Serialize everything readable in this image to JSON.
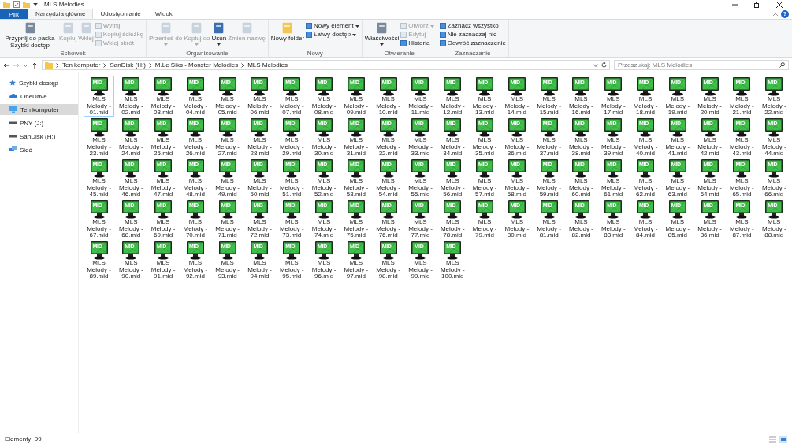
{
  "window": {
    "title": "MLS Melodies",
    "help": "?"
  },
  "tabs": [
    {
      "label": "Plik",
      "kind": "file",
      "selected": false
    },
    {
      "label": "Narzędzia główne",
      "kind": "tab",
      "selected": true
    },
    {
      "label": "Udostępnianie",
      "kind": "tab",
      "selected": false
    },
    {
      "label": "Widok",
      "kind": "tab",
      "selected": false
    }
  ],
  "ribbon": [
    {
      "name": "Schowek",
      "items": [
        {
          "label": "Przypnij do paska Szybki dostęp",
          "kind": "large",
          "disabled": false,
          "dropdown": false
        },
        {
          "label": "Kopiuj",
          "kind": "large",
          "disabled": true,
          "dropdown": false
        },
        {
          "label": "Wklej",
          "kind": "large",
          "disabled": true,
          "dropdown": false
        },
        {
          "label": "Wytnij",
          "kind": "small",
          "disabled": true,
          "dropdown": false
        },
        {
          "label": "Kopiuj ścieżkę",
          "kind": "small",
          "disabled": true,
          "dropdown": false
        },
        {
          "label": "Wklej skrót",
          "kind": "small",
          "disabled": true,
          "dropdown": false
        }
      ]
    },
    {
      "name": "Organizowanie",
      "items": [
        {
          "label": "Przenieś do",
          "kind": "large",
          "disabled": true,
          "dropdown": true
        },
        {
          "label": "Kopiuj do",
          "kind": "large",
          "disabled": true,
          "dropdown": true
        },
        {
          "label": "Usuń",
          "kind": "large",
          "disabled": false,
          "dropdown": true
        },
        {
          "label": "Zmień nazwę",
          "kind": "large",
          "disabled": true,
          "dropdown": false
        }
      ]
    },
    {
      "name": "Nowy",
      "items": [
        {
          "label": "Nowy folder",
          "kind": "large",
          "disabled": false,
          "dropdown": false
        },
        {
          "label": "Nowy element",
          "kind": "small",
          "disabled": false,
          "dropdown": true
        },
        {
          "label": "Łatwy dostęp",
          "kind": "small",
          "disabled": false,
          "dropdown": true
        }
      ]
    },
    {
      "name": "Otwieranie",
      "items": [
        {
          "label": "Właściwości",
          "kind": "large",
          "disabled": false,
          "dropdown": true
        },
        {
          "label": "Otwórz",
          "kind": "small",
          "disabled": true,
          "dropdown": true
        },
        {
          "label": "Edytuj",
          "kind": "small",
          "disabled": true,
          "dropdown": false
        },
        {
          "label": "Historia",
          "kind": "small",
          "disabled": false,
          "dropdown": false
        }
      ]
    },
    {
      "name": "Zaznaczanie",
      "items": [
        {
          "label": "Zaznacz wszystko",
          "kind": "small",
          "disabled": false,
          "dropdown": false
        },
        {
          "label": "Nie zaznaczaj nic",
          "kind": "small",
          "disabled": false,
          "dropdown": false
        },
        {
          "label": "Odwróć zaznaczenie",
          "kind": "small",
          "disabled": false,
          "dropdown": false
        }
      ]
    }
  ],
  "address": {
    "crumbs": [
      "Ten komputer",
      "SanDisk (H:)",
      "M.Le Siks - Monster Melodies",
      "MLS Melodies"
    ]
  },
  "search": {
    "placeholder": "Przeszukaj: MLS Melodies"
  },
  "sidebar": {
    "items": [
      {
        "label": "Szybki dostęp",
        "kind": "star",
        "selected": false
      },
      {
        "label": "OneDrive",
        "kind": "cloud",
        "selected": false
      },
      {
        "label": "Ten komputer",
        "kind": "pc",
        "selected": true
      },
      {
        "label": "PNY (J:)",
        "kind": "drive",
        "selected": false
      },
      {
        "label": "SanDisk (H:)",
        "kind": "drive",
        "selected": false
      },
      {
        "label": "Sieć",
        "kind": "network",
        "selected": false
      }
    ]
  },
  "files": [
    {
      "name": "MLS Melody - 01.mid",
      "badge": "MID",
      "selected": true
    },
    {
      "name": "MLS Melody - 02.mid",
      "badge": "MID",
      "selected": false
    },
    {
      "name": "MLS Melody - 03.mid",
      "badge": "MID",
      "selected": false
    },
    {
      "name": "MLS Melody - 04.mid",
      "badge": "MID",
      "selected": false
    },
    {
      "name": "MLS Melody - 05.mid",
      "badge": "MID",
      "selected": false
    },
    {
      "name": "MLS Melody - 06.mid",
      "badge": "MID",
      "selected": false
    },
    {
      "name": "MLS Melody - 07.mid",
      "badge": "MID",
      "selected": false
    },
    {
      "name": "MLS Melody - 08.mid",
      "badge": "MID",
      "selected": false
    },
    {
      "name": "MLS Melody - 09.mid",
      "badge": "MID",
      "selected": false
    },
    {
      "name": "MLS Melody - 10.mid",
      "badge": "MID",
      "selected": false
    },
    {
      "name": "MLS Melody - 11.mid",
      "badge": "MID",
      "selected": false
    },
    {
      "name": "MLS Melody - 12.mid",
      "badge": "MID",
      "selected": false
    },
    {
      "name": "MLS Melody - 13.mid",
      "badge": "MID",
      "selected": false
    },
    {
      "name": "MLS Melody - 14.mid",
      "badge": "MID",
      "selected": false
    },
    {
      "name": "MLS Melody - 15.mid",
      "badge": "MID",
      "selected": false
    },
    {
      "name": "MLS Melody - 16.mid",
      "badge": "MID",
      "selected": false
    },
    {
      "name": "MLS Melody - 17.mid",
      "badge": "MID",
      "selected": false
    },
    {
      "name": "MLS Melody - 18.mid",
      "badge": "MID",
      "selected": false
    },
    {
      "name": "MLS Melody - 19.mid",
      "badge": "MID",
      "selected": false
    },
    {
      "name": "MLS Melody - 20.mid",
      "badge": "MID",
      "selected": false
    },
    {
      "name": "MLS Melody - 21.mid",
      "badge": "MID",
      "selected": false
    },
    {
      "name": "MLS Melody - 22.mid",
      "badge": "MID",
      "selected": false
    },
    {
      "name": "MLS Melody - 23.mid",
      "badge": "MID",
      "selected": false
    },
    {
      "name": "MLS Melody - 24.mid",
      "badge": "MID",
      "selected": false
    },
    {
      "name": "MLS Melody - 25.mid",
      "badge": "MID",
      "selected": false
    },
    {
      "name": "MLS Melody - 26.mid",
      "badge": "MID",
      "selected": false
    },
    {
      "name": "MLS Melody - 27.mid",
      "badge": "MID",
      "selected": false
    },
    {
      "name": "MLS Melody - 28.mid",
      "badge": "MID",
      "selected": false
    },
    {
      "name": "MLS Melody - 29.mid",
      "badge": "MID",
      "selected": false
    },
    {
      "name": "MLS Melody - 30.mid",
      "badge": "MID",
      "selected": false
    },
    {
      "name": "MLS Melody - 31.mid",
      "badge": "MID",
      "selected": false
    },
    {
      "name": "MLS Melody - 32.mid",
      "badge": "MID",
      "selected": false
    },
    {
      "name": "MLS Melody - 33.mid",
      "badge": "MID",
      "selected": false
    },
    {
      "name": "MLS Melody - 34.mid",
      "badge": "MID",
      "selected": false
    },
    {
      "name": "MLS Melody - 35.mid",
      "badge": "MID",
      "selected": false
    },
    {
      "name": "MLS Melody - 36.mid",
      "badge": "MID",
      "selected": false
    },
    {
      "name": "MLS Melody - 37.mid",
      "badge": "MID",
      "selected": false
    },
    {
      "name": "MLS Melody - 38.mid",
      "badge": "MID",
      "selected": false
    },
    {
      "name": "MLS Melody - 39.mid",
      "badge": "MID",
      "selected": false
    },
    {
      "name": "MLS Melody - 40.mid",
      "badge": "MID",
      "selected": false
    },
    {
      "name": "MLS Melody - 41.mid",
      "badge": "MID",
      "selected": false
    },
    {
      "name": "MLS Melody - 42.mid",
      "badge": "MID",
      "selected": false
    },
    {
      "name": "MLS Melody - 43.mid",
      "badge": "MID",
      "selected": false
    },
    {
      "name": "MLS Melody - 44.mid",
      "badge": "MID",
      "selected": false
    },
    {
      "name": "MLS Melody - 45.mid",
      "badge": "MID",
      "selected": false
    },
    {
      "name": "MLS Melody - 46.mid",
      "badge": "MID",
      "selected": false
    },
    {
      "name": "MLS Melody - 47.mid",
      "badge": "MID",
      "selected": false
    },
    {
      "name": "MLS Melody - 48.mid",
      "badge": "MID",
      "selected": false
    },
    {
      "name": "MLS Melody - 49.mid",
      "badge": "MID",
      "selected": false
    },
    {
      "name": "MLS Melody - 50.mid",
      "badge": "MID",
      "selected": false
    },
    {
      "name": "MLS Melody - 51.mid",
      "badge": "MID",
      "selected": false
    },
    {
      "name": "MLS Melody - 52.mid",
      "badge": "MID",
      "selected": false
    },
    {
      "name": "MLS Melody - 53.mid",
      "badge": "MID",
      "selected": false
    },
    {
      "name": "MLS Melody - 54.mid",
      "badge": "MID",
      "selected": false
    },
    {
      "name": "MLS Melody - 55.mid",
      "badge": "MID",
      "selected": false
    },
    {
      "name": "MLS Melody - 56.mid",
      "badge": "MID",
      "selected": false
    },
    {
      "name": "MLS Melody - 57.mid",
      "badge": "MID",
      "selected": false
    },
    {
      "name": "MLS Melody - 58.mid",
      "badge": "MID",
      "selected": false
    },
    {
      "name": "MLS Melody - 59.mid",
      "badge": "MID",
      "selected": false
    },
    {
      "name": "MLS Melody - 60.mid",
      "badge": "MID",
      "selected": false
    },
    {
      "name": "MLS Melody - 61.mid",
      "badge": "MID",
      "selected": false
    },
    {
      "name": "MLS Melody - 62.mid",
      "badge": "MID",
      "selected": false
    },
    {
      "name": "MLS Melody - 63.mid",
      "badge": "MID",
      "selected": false
    },
    {
      "name": "MLS Melody - 64.mid",
      "badge": "MID",
      "selected": false
    },
    {
      "name": "MLS Melody - 65.mid",
      "badge": "MID",
      "selected": false
    },
    {
      "name": "MLS Melody - 66.mid",
      "badge": "MID",
      "selected": false
    },
    {
      "name": "MLS Melody - 67.mid",
      "badge": "MID",
      "selected": false
    },
    {
      "name": "MLS Melody - 68.mid",
      "badge": "MID",
      "selected": false
    },
    {
      "name": "MLS Melody - 69.mid",
      "badge": "MID",
      "selected": false
    },
    {
      "name": "MLS Melody - 70.mid",
      "badge": "MID",
      "selected": false
    },
    {
      "name": "MLS Melody - 71.mid",
      "badge": "MID",
      "selected": false
    },
    {
      "name": "MLS Melody - 72.mid",
      "badge": "MID",
      "selected": false
    },
    {
      "name": "MLS Melody - 73.mid",
      "badge": "MID",
      "selected": false
    },
    {
      "name": "MLS Melody - 74.mid",
      "badge": "MID",
      "selected": false
    },
    {
      "name": "MLS Melody - 75.mid",
      "badge": "MID",
      "selected": false
    },
    {
      "name": "MLS Melody - 76.mid",
      "badge": "MID",
      "selected": false
    },
    {
      "name": "MLS Melody - 77.mid",
      "badge": "MID",
      "selected": false
    },
    {
      "name": "MLS Melody - 78.mid",
      "badge": "MID",
      "selected": false
    },
    {
      "name": "MLS Melody - 79.mid",
      "badge": "MID",
      "selected": false
    },
    {
      "name": "MLS Melody - 80.mid",
      "badge": "MID",
      "selected": false
    },
    {
      "name": "MLS Melody - 81.mid",
      "badge": "MID",
      "selected": false
    },
    {
      "name": "MLS Melody - 82.mid",
      "badge": "MID",
      "selected": false
    },
    {
      "name": "MLS Melody - 83.mid",
      "badge": "MID",
      "selected": false
    },
    {
      "name": "MLS Melody - 84.mid",
      "badge": "MID",
      "selected": false
    },
    {
      "name": "MLS Melody - 85.mid",
      "badge": "MID",
      "selected": false
    },
    {
      "name": "MLS Melody - 86.mid",
      "badge": "MID",
      "selected": false
    },
    {
      "name": "MLS Melody - 87.mid",
      "badge": "MID",
      "selected": false
    },
    {
      "name": "MLS Melody - 88.mid",
      "badge": "MID",
      "selected": false
    },
    {
      "name": "MLS Melody - 89.mid",
      "badge": "MID",
      "selected": false
    },
    {
      "name": "MLS Melody - 90.mid",
      "badge": "MID",
      "selected": false
    },
    {
      "name": "MLS Melody - 91.mid",
      "badge": "MID",
      "selected": false
    },
    {
      "name": "MLS Melody - 92.mid",
      "badge": "MID",
      "selected": false
    },
    {
      "name": "MLS Melody - 93.mid",
      "badge": "MID",
      "selected": false
    },
    {
      "name": "MLS Melody - 94.mid",
      "badge": "MID",
      "selected": false
    },
    {
      "name": "MLS Melody - 95.mid",
      "badge": "MID",
      "selected": false
    },
    {
      "name": "MLS Melody - 96.mid",
      "badge": "MID",
      "selected": false
    },
    {
      "name": "MLS Melody - 97.mid",
      "badge": "MID",
      "selected": false
    },
    {
      "name": "MLS Melody - 98.mid",
      "badge": "MID",
      "selected": false
    },
    {
      "name": "MLS Melody - 99.mid",
      "badge": "MID",
      "selected": false
    },
    {
      "name": "MLS Melody - 100.mid",
      "badge": "MID",
      "selected": false
    }
  ],
  "status_bar": {
    "text": "Elementy: 99"
  }
}
